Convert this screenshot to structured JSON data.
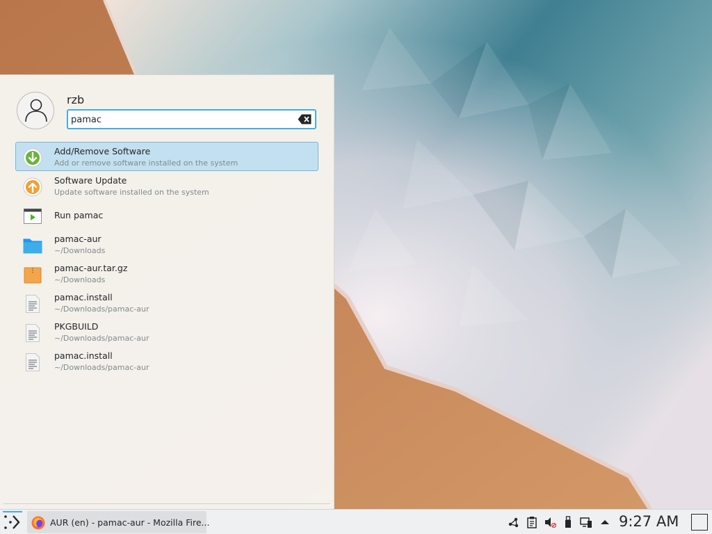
{
  "launcher": {
    "user_name": "rzb",
    "search": {
      "value": "pamac"
    },
    "results": [
      {
        "title": "Add/Remove Software",
        "subtitle": "Add or remove software installed on the system",
        "icon": "software-install-icon",
        "selected": true
      },
      {
        "title": "Software Update",
        "subtitle": "Update software installed on the system",
        "icon": "software-update-icon"
      },
      {
        "title": "Run pamac",
        "subtitle": "",
        "icon": "run-command-icon"
      },
      {
        "title": "pamac-aur",
        "subtitle": "~/Downloads",
        "icon": "folder-icon"
      },
      {
        "title": "pamac-aur.tar.gz",
        "subtitle": "~/Downloads",
        "icon": "archive-icon"
      },
      {
        "title": "pamac.install",
        "subtitle": "~/Downloads/pamac-aur",
        "icon": "text-file-icon"
      },
      {
        "title": "PKGBUILD",
        "subtitle": "~/Downloads/pamac-aur",
        "icon": "text-file-icon"
      },
      {
        "title": "pamac.install",
        "subtitle": "~/Downloads/pamac-aur",
        "icon": "text-file-icon"
      }
    ]
  },
  "taskbar": {
    "task": {
      "label": "AUR (en) - pamac-aur - Mozilla Fire...",
      "icon": "firefox-icon"
    },
    "tray": [
      "network-icon",
      "clipboard-icon",
      "volume-muted-icon",
      "usb-device-icon",
      "display-icon",
      "expand-tray-icon"
    ],
    "clock": "9:27 AM"
  },
  "colors": {
    "accent": "#3daee9",
    "selection": "#c3e0f0",
    "install_green": "#6bb33b",
    "update_orange": "#f0a135",
    "folder_blue": "#3daee9"
  }
}
